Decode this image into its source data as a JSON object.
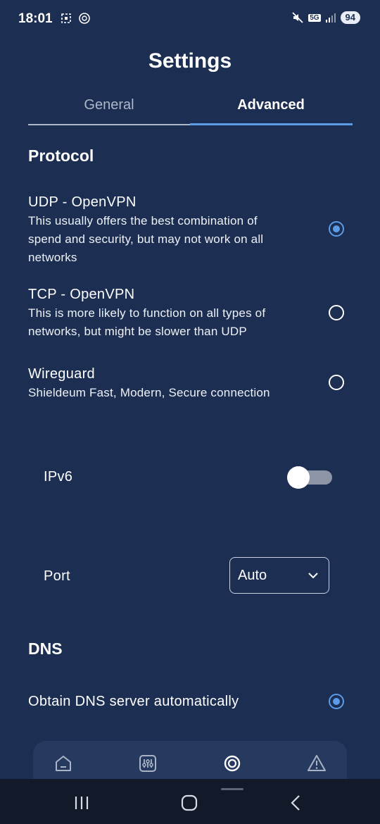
{
  "status_bar": {
    "time": "18:01",
    "battery": "94",
    "network": "5G"
  },
  "header": {
    "title": "Settings"
  },
  "tabs": [
    {
      "label": "General",
      "active": false
    },
    {
      "label": "Advanced",
      "active": true
    }
  ],
  "protocol": {
    "heading": "Protocol",
    "options": [
      {
        "title": "UDP - OpenVPN",
        "desc_lines": [
          "This usually offers the best combination of",
          "spend and security, but may not work on all",
          "networks"
        ],
        "selected": true
      },
      {
        "title": "TCP - OpenVPN",
        "desc_lines": [
          "This is more likely to function on all types of",
          "networks, but might be slower than UDP"
        ],
        "selected": false
      },
      {
        "title": "Wireguard",
        "desc_lines": [
          "Shieldeum Fast, Modern, Secure connection"
        ],
        "selected": false
      }
    ]
  },
  "ipv6": {
    "label": "IPv6",
    "enabled": false
  },
  "port": {
    "label": "Port",
    "value": "Auto"
  },
  "dns": {
    "heading": "DNS",
    "options": [
      {
        "title": "Obtain DNS server automatically",
        "selected": true
      }
    ]
  },
  "bottom_nav": {
    "items": [
      {
        "icon": "home-icon"
      },
      {
        "icon": "sliders-icon"
      },
      {
        "icon": "settings-gear-icon",
        "active": true
      },
      {
        "icon": "warning-icon"
      }
    ]
  },
  "colors": {
    "background": "#1c2e52",
    "accent": "#5b9be8",
    "nav_bg": "#263a60"
  }
}
